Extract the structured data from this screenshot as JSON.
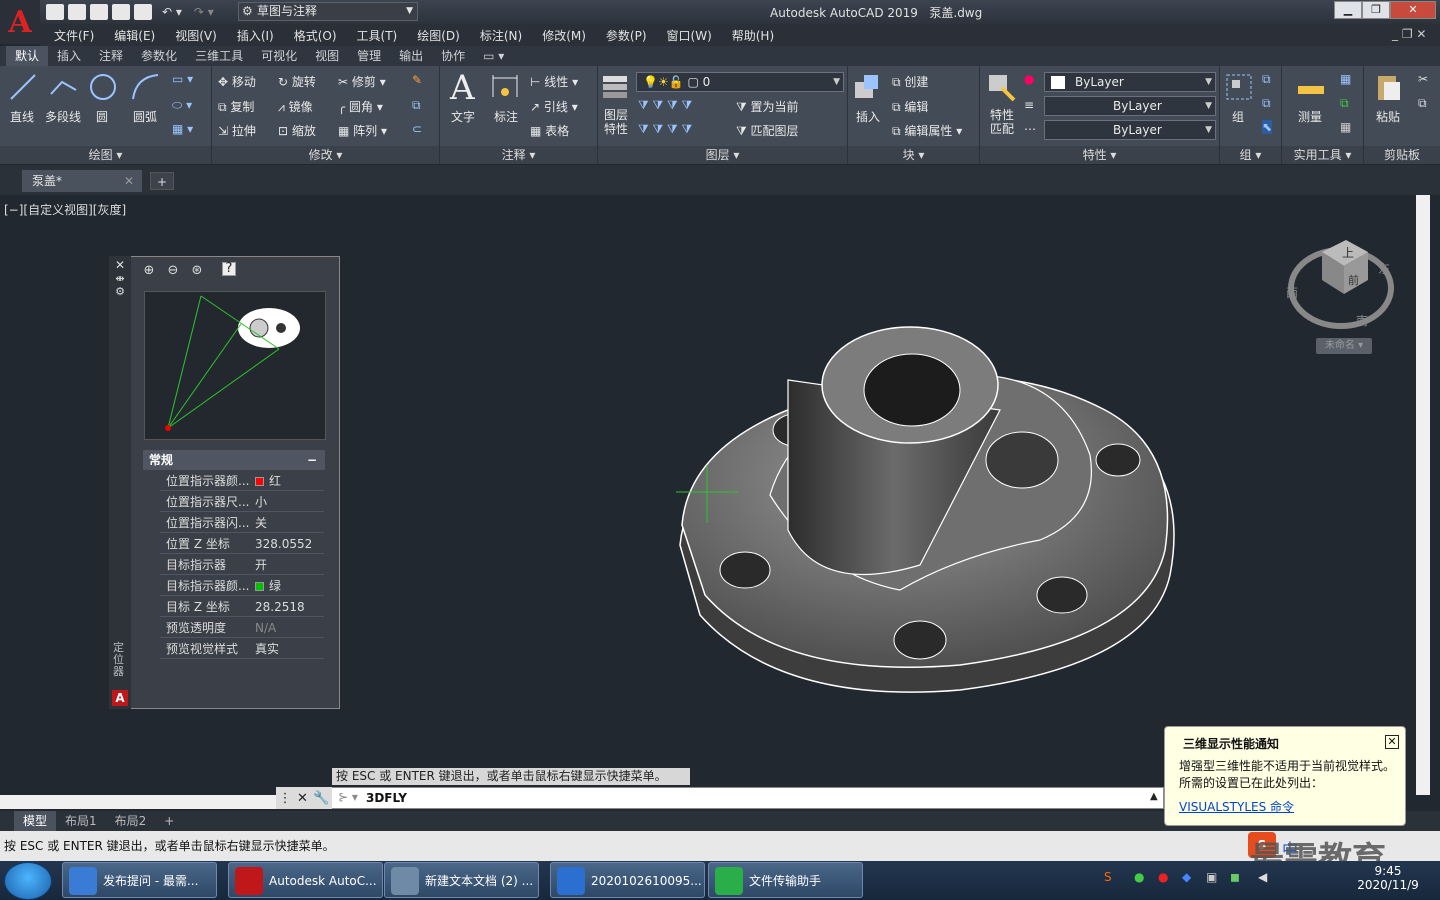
{
  "window": {
    "title": "Autodesk AutoCAD 2019",
    "filename": "泵盖.dwg"
  },
  "workspace": {
    "label": "草图与注释"
  },
  "menu": [
    "文件(F)",
    "编辑(E)",
    "视图(V)",
    "插入(I)",
    "格式(O)",
    "工具(T)",
    "绘图(D)",
    "标注(N)",
    "修改(M)",
    "参数(P)",
    "窗口(W)",
    "帮助(H)"
  ],
  "ribbon_tabs": [
    "默认",
    "插入",
    "注释",
    "参数化",
    "三维工具",
    "可视化",
    "视图",
    "管理",
    "输出",
    "协作"
  ],
  "draw": {
    "line": "直线",
    "polyline": "多段线",
    "circle": "圆",
    "arc": "圆弧",
    "title": "绘图"
  },
  "modify": {
    "move": "移动",
    "rotate": "旋转",
    "trim": "修剪",
    "copy": "复制",
    "mirror": "镜像",
    "fillet": "圆角",
    "stretch": "拉伸",
    "scale": "缩放",
    "array": "阵列",
    "title": "修改"
  },
  "annotation": {
    "text": "文字",
    "dimension": "标注",
    "linear": "线性",
    "leader": "引线",
    "table": "表格",
    "title": "注释"
  },
  "layers": {
    "props_line1": "图层",
    "props_line2": "特性",
    "current_layer": "0",
    "set_current": "置为当前",
    "match_layer": "匹配图层",
    "title": "图层"
  },
  "block": {
    "insert": "插入",
    "create": "创建",
    "edit": "编辑",
    "edit_attr": "编辑属性",
    "title": "块"
  },
  "properties": {
    "match1": "特性",
    "match2": "匹配",
    "color": "ByLayer",
    "linetype": "ByLayer",
    "lineweight": "ByLayer",
    "title": "特性"
  },
  "groups": {
    "group": "组",
    "title": "组"
  },
  "utilities": {
    "measure": "测量",
    "title": "实用工具"
  },
  "clipboard": {
    "paste": "粘贴",
    "title": "剪贴板"
  },
  "doc_tab": "泵盖*",
  "view_label": "[−][自定义视图][灰度]",
  "navigator": {
    "side_label": "定位器",
    "section": "常规",
    "rows": [
      {
        "k": "位置指示器颜...",
        "v": "红",
        "sw": "#ff0000"
      },
      {
        "k": "位置指示器尺...",
        "v": "小"
      },
      {
        "k": "位置指示器闪...",
        "v": "关"
      },
      {
        "k": "位置 Z 坐标",
        "v": "328.0552"
      },
      {
        "k": "目标指示器",
        "v": "开"
      },
      {
        "k": "目标指示器颜...",
        "v": "绿",
        "sw": "#00c000"
      },
      {
        "k": "目标 Z 坐标",
        "v": "28.2518"
      },
      {
        "k": "预览透明度",
        "v": "N/A"
      },
      {
        "k": "预览视觉样式",
        "v": "真实"
      }
    ]
  },
  "viewcube": {
    "top": "上",
    "front": "南",
    "east": "东",
    "west": "西",
    "north": "前",
    "wcs": "未命名"
  },
  "tooltip": "按 ESC 或 ENTER 键退出，或者单击鼠标右键显示快捷菜单。",
  "command": "3DFLY",
  "layout_tabs": [
    "模型",
    "布局1",
    "布局2"
  ],
  "status": "按 ESC 或 ENTER 键退出，或者单击鼠标右键显示快捷菜单。",
  "notification": {
    "title": "三维显示性能通知",
    "body1": "增强型三维性能不适用于当前视觉样式。",
    "body2": "所需的设置已在此处列出：",
    "link": "VISUALSTYLES 命令"
  },
  "taskbar": [
    {
      "label": "发布提问 - 最需...",
      "color": "#3a7bd5"
    },
    {
      "label": "Autodesk AutoC...",
      "color": "#c0171b"
    },
    {
      "label": "新建文本文档 (2) ...",
      "color": "#6e8aa6"
    },
    {
      "label": "2020102610095...",
      "color": "#2b6fd1"
    },
    {
      "label": "文件传输助手",
      "color": "#2aae4a"
    }
  ],
  "clock": {
    "date": "2020/11/9",
    "time": "9:45"
  },
  "watermark": "最需教育",
  "ime": "中"
}
